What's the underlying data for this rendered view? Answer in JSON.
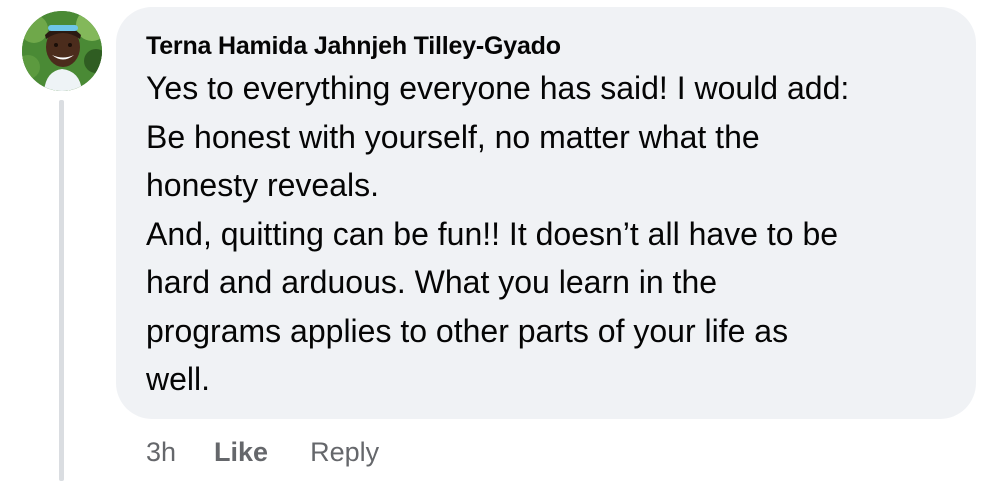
{
  "comment": {
    "author": "Terna Hamida Jahnjeh Tilley-Gyado",
    "lines": [
      "Yes to everything everyone has said! I would add:",
      "Be honest with yourself, no matter what the",
      "honesty reveals.",
      "And, quitting can be fun!! It doesn’t all have to be",
      "hard and arduous. What you learn in the",
      "programs applies to other parts of your life as",
      "well."
    ],
    "avatar_icon": "user-profile-photo"
  },
  "actions": {
    "time": "3h",
    "like_label": "Like",
    "reply_label": "Reply"
  },
  "colors": {
    "bubble": "#f0f2f5",
    "text": "#050505",
    "secondary_text": "#65676b",
    "thread_line": "#dadde1"
  }
}
